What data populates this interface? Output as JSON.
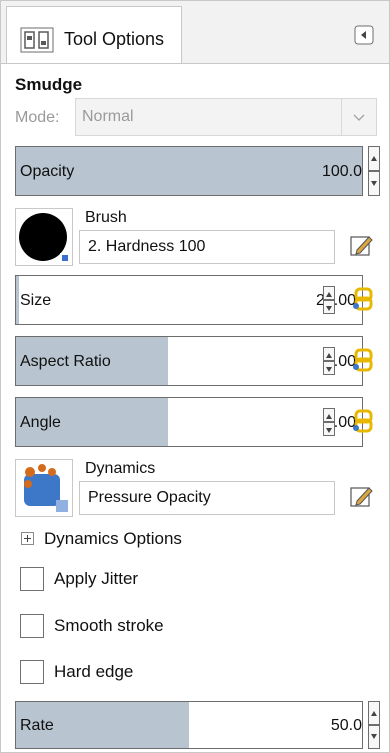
{
  "tab": {
    "label": "Tool Options",
    "icon": "tool-options-icon",
    "collapse_icon": "collapse-left-icon"
  },
  "tool": {
    "name": "Smudge"
  },
  "mode": {
    "label": "Mode:",
    "value": "Normal"
  },
  "opacity": {
    "label": "Opacity",
    "value": "100.0",
    "fill_percent": 100
  },
  "brush": {
    "label": "Brush",
    "value": "2. Hardness 100",
    "icon": "brush-preview-icon",
    "edit_icon": "edit-icon"
  },
  "size": {
    "label": "Size",
    "value": "20.00",
    "fill_fraction": 0.01,
    "link_icon": "chain-link-icon"
  },
  "aspect_ratio": {
    "label": "Aspect Ratio",
    "value": "0.00",
    "fill_fraction": 0.44,
    "link_icon": "chain-link-icon"
  },
  "angle": {
    "label": "Angle",
    "value": "0.00",
    "fill_fraction": 0.44,
    "link_icon": "chain-link-icon"
  },
  "dynamics": {
    "label": "Dynamics",
    "value": "Pressure Opacity",
    "icon": "dynamics-icon",
    "edit_icon": "edit-icon"
  },
  "dynamics_options": {
    "label": "Dynamics Options",
    "expanded": false
  },
  "checkboxes": [
    {
      "label": "Apply Jitter",
      "checked": false
    },
    {
      "label": "Smooth stroke",
      "checked": false
    },
    {
      "label": "Hard edge",
      "checked": false
    }
  ],
  "rate": {
    "label": "Rate",
    "value": "50.0",
    "fill_percent": 50
  },
  "colors": {
    "slider_fill": "#b8c4cf",
    "border": "#6d6d6d",
    "disabled_text": "#9a9a9a"
  }
}
